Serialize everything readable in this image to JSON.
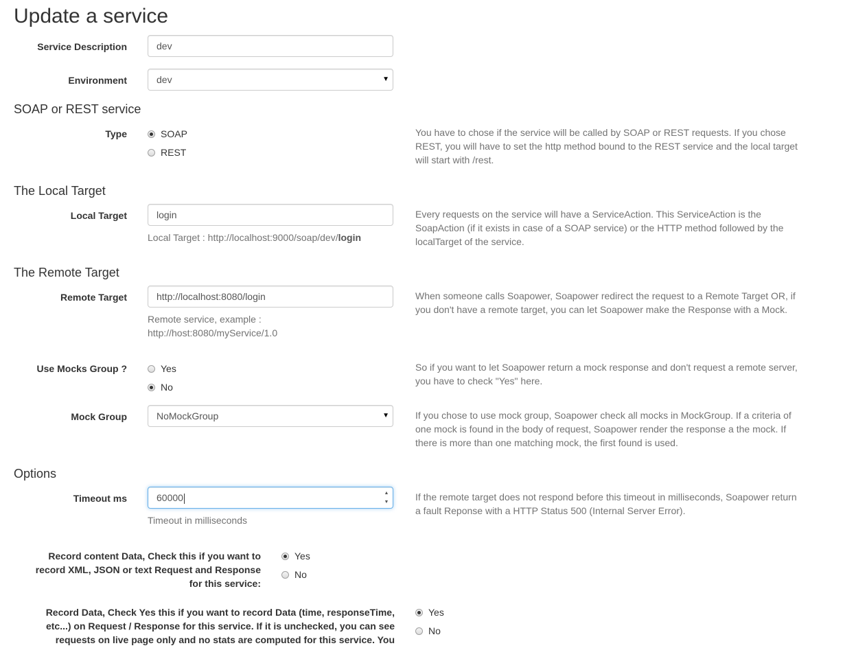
{
  "page_title": "Update a service",
  "fields": {
    "service_description": {
      "label": "Service Description",
      "value": "dev"
    },
    "environment": {
      "label": "Environment",
      "value": "dev"
    }
  },
  "soap_rest": {
    "section": "SOAP or REST service",
    "type_label": "Type",
    "options": [
      "SOAP",
      "REST"
    ],
    "selected": "SOAP",
    "description": "You have to chose if the service will be called by SOAP or REST requests. If you chose REST, you will have to set the http method bound to the REST service and the local target will start with /rest."
  },
  "local_target": {
    "section": "The Local Target",
    "label": "Local Target",
    "value": "login",
    "help_prefix": "Local Target : http://localhost:9000/soap/dev/",
    "help_bold": "login",
    "description": "Every requests on the service will have a ServiceAction. This ServiceAction is the SoapAction (if it exists in case of a SOAP service) or the HTTP method followed by the localTarget of the service."
  },
  "remote_target": {
    "section": "The Remote Target",
    "label": "Remote Target",
    "value": "http://localhost:8080/login",
    "help_line1": "Remote service, example :",
    "help_line2": "http://host:8080/myService/1.0",
    "description": "When someone calls Soapower, Soapower redirect the request to a Remote Target OR, if you don't have a remote target, you can let Soapower make the Response with a Mock."
  },
  "mocks_group": {
    "label": "Use Mocks Group ?",
    "options": [
      "Yes",
      "No"
    ],
    "selected": "No",
    "description": "So if you want to let Soapower return a mock response and don't request a remote server, you have to check \"Yes\" here."
  },
  "mock_group": {
    "label": "Mock Group",
    "value": "NoMockGroup",
    "description": "If you chose to use mock group, Soapower check all mocks in MockGroup. If a criteria of one mock is found in the body of request, Soapower render the response a the mock. If there is more than one matching mock, the first found is used."
  },
  "options": {
    "section": "Options",
    "timeout_label": "Timeout ms",
    "timeout_value": "60000",
    "timeout_help": "Timeout in milliseconds",
    "timeout_description": "If the remote target does not respond before this timeout in milliseconds, Soapower return a fault Reponse with a HTTP Status 500 (Internal Server Error)."
  },
  "record_content": {
    "label_line1": "Record content Data, Check this if you want to",
    "label_line2": "record XML, JSON or text Request and Response",
    "label_line3": "for this service:",
    "options": [
      "Yes",
      "No"
    ],
    "selected": "Yes"
  },
  "record_data": {
    "label_line1": "Record Data, Check Yes this if you want to record Data (time, responseTime,",
    "label_line2": "etc...) on Request / Response for this service. If it is unchecked, you can see",
    "label_line3": "requests on live page only and no stats are computed for this service. You",
    "options": [
      "Yes",
      "No"
    ],
    "selected": "Yes"
  }
}
